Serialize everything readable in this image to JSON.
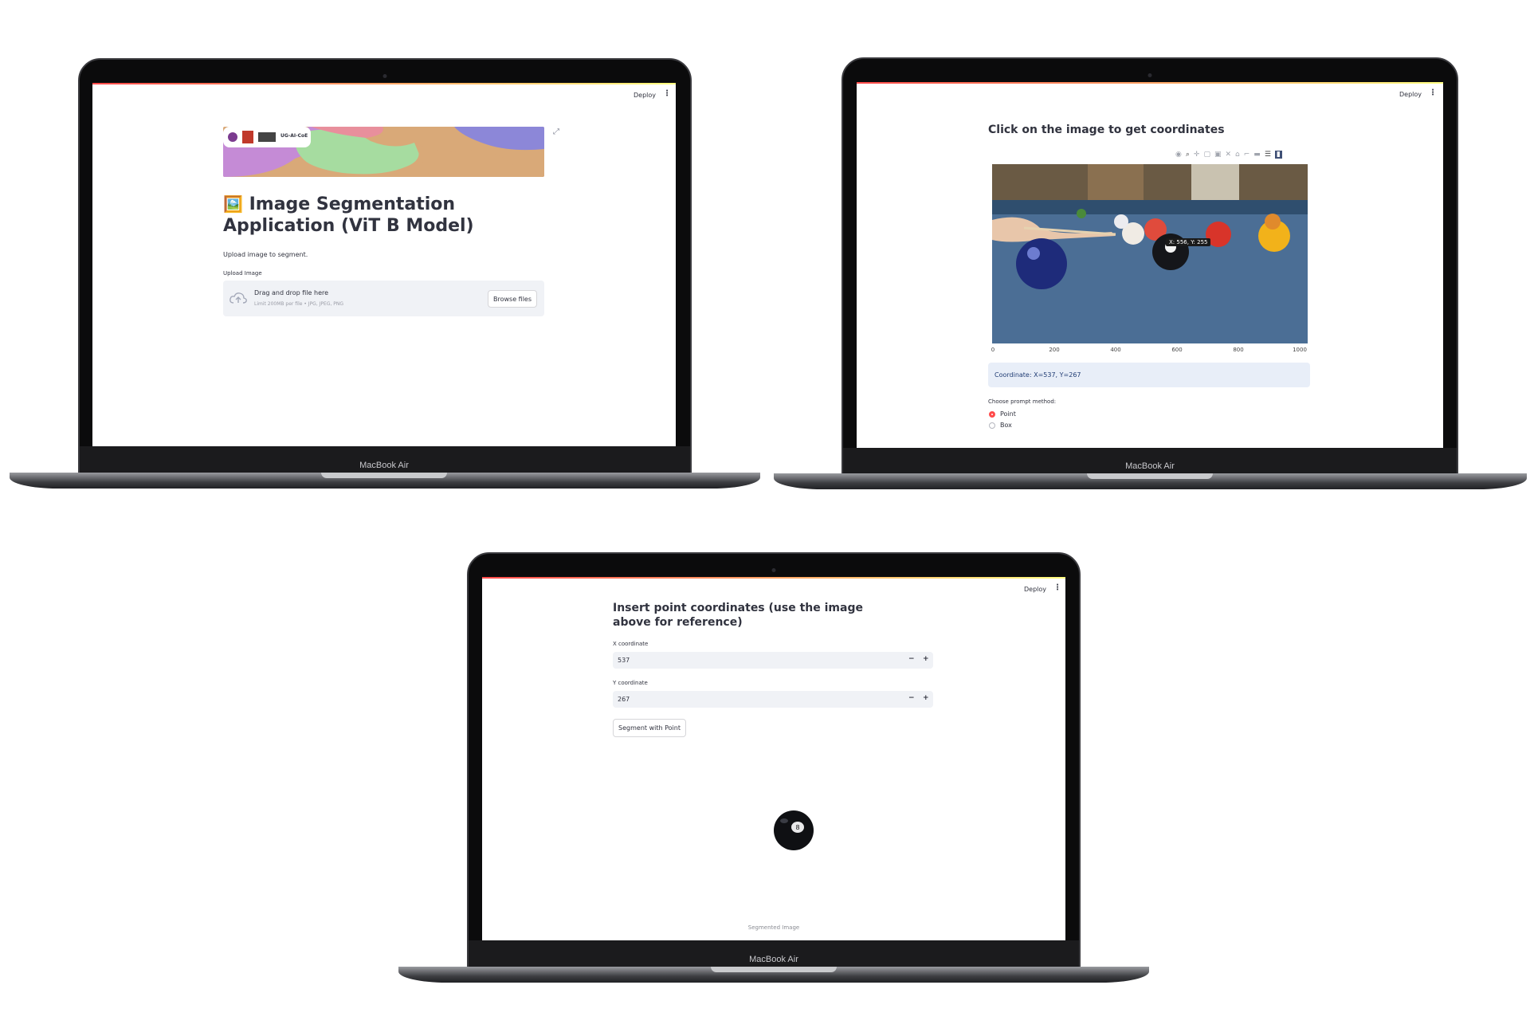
{
  "device": {
    "brand_label": "MacBook Air"
  },
  "header": {
    "deploy_label": "Deploy",
    "menu_icon": "kebab-menu-icon"
  },
  "screen1": {
    "banner_logo_text": "UG-AI-CoE",
    "title_emoji": "🖼️",
    "title": "Image Segmentation Application (ViT B Model)",
    "subtitle": "Upload image to segment.",
    "upload_label": "Upload Image",
    "dropzone_text": "Drag and drop file here",
    "dropzone_hint": "Limit 200MB per file • JPG, JPEG, PNG",
    "browse_label": "Browse files",
    "expand_icon": "expand-icon",
    "upload_icon": "cloud-upload-icon"
  },
  "screen2": {
    "heading": "Click on the image to get coordinates",
    "toolbar_icons": [
      "camera-icon",
      "zoom-icon",
      "pan-icon",
      "box-select-icon",
      "lasso-icon",
      "autoscale-icon",
      "home-icon",
      "spike-icon",
      "compare-icon",
      "closest-icon",
      "plotly-logo-icon"
    ],
    "hover_label": "X: 556, Y: 255",
    "x_ticks": [
      "0",
      "200",
      "400",
      "600",
      "800",
      "1000"
    ],
    "coordinate_text": "Coordinate: X=537, Y=267",
    "prompt_label": "Choose prompt method:",
    "options": [
      "Point",
      "Box"
    ],
    "selected_option": "Point",
    "accent_color": "#ff4b4b"
  },
  "screen3": {
    "heading": "Insert point coordinates (use the image above for reference)",
    "x_label": "X coordinate",
    "x_value": "537",
    "y_label": "Y coordinate",
    "y_value": "267",
    "minus": "−",
    "plus": "+",
    "segment_button": "Segment with Point",
    "caption": "Segmented Image"
  }
}
